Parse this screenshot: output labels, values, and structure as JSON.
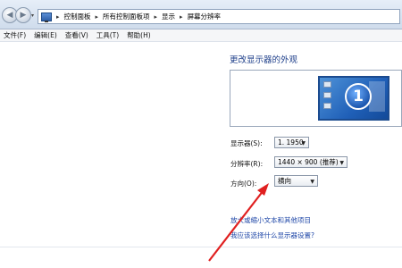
{
  "breadcrumbs": [
    "控制面板",
    "所有控制面板项",
    "显示",
    "屏幕分辨率"
  ],
  "menu": [
    "文件(F)",
    "编辑(E)",
    "查看(V)",
    "工具(T)",
    "帮助(H)"
  ],
  "heading": "更改显示器的外观",
  "monitor_number": "1",
  "display": {
    "label": "显示器(S):",
    "value": "1. 1950"
  },
  "resolution": {
    "label": "分辨率(R):",
    "value": "1440 × 900 (推荐)"
  },
  "orientation": {
    "label": "方向(O):",
    "value": "横向"
  },
  "links": {
    "text_size": "放大或缩小文本和其他项目",
    "which_settings": "我应该选择什么显示器设置?"
  },
  "colors": {
    "link": "#2048a8",
    "heading": "#1e3f8a",
    "arrow": "#e02020"
  }
}
